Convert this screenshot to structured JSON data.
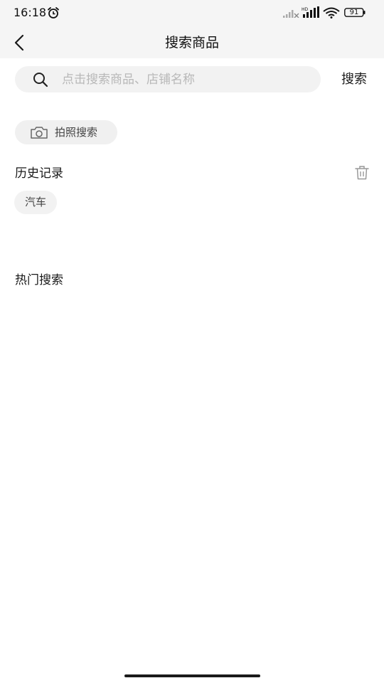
{
  "status_bar": {
    "time": "16:18",
    "battery": "91",
    "network_label": "HD"
  },
  "nav": {
    "title": "搜索商品"
  },
  "search": {
    "placeholder": "点击搜索商品、店铺名称",
    "value": "",
    "button_label": "搜索"
  },
  "photo_search": {
    "label": "拍照搜索"
  },
  "history": {
    "title": "历史记录",
    "items": [
      "汽车"
    ]
  },
  "hot": {
    "title": "热门搜索"
  },
  "icons": {
    "alarm": "alarm-clock-icon",
    "back": "chevron-left-icon",
    "search": "search-icon",
    "camera": "camera-icon",
    "trash": "trash-icon",
    "wifi": "wifi-icon",
    "signal": "cellular-signal-icon",
    "battery": "battery-icon"
  },
  "colors": {
    "header_bg": "#f5f5f5",
    "chip_bg": "#f2f2f2",
    "placeholder": "#b8b8b8",
    "text": "#1a1a1a"
  }
}
